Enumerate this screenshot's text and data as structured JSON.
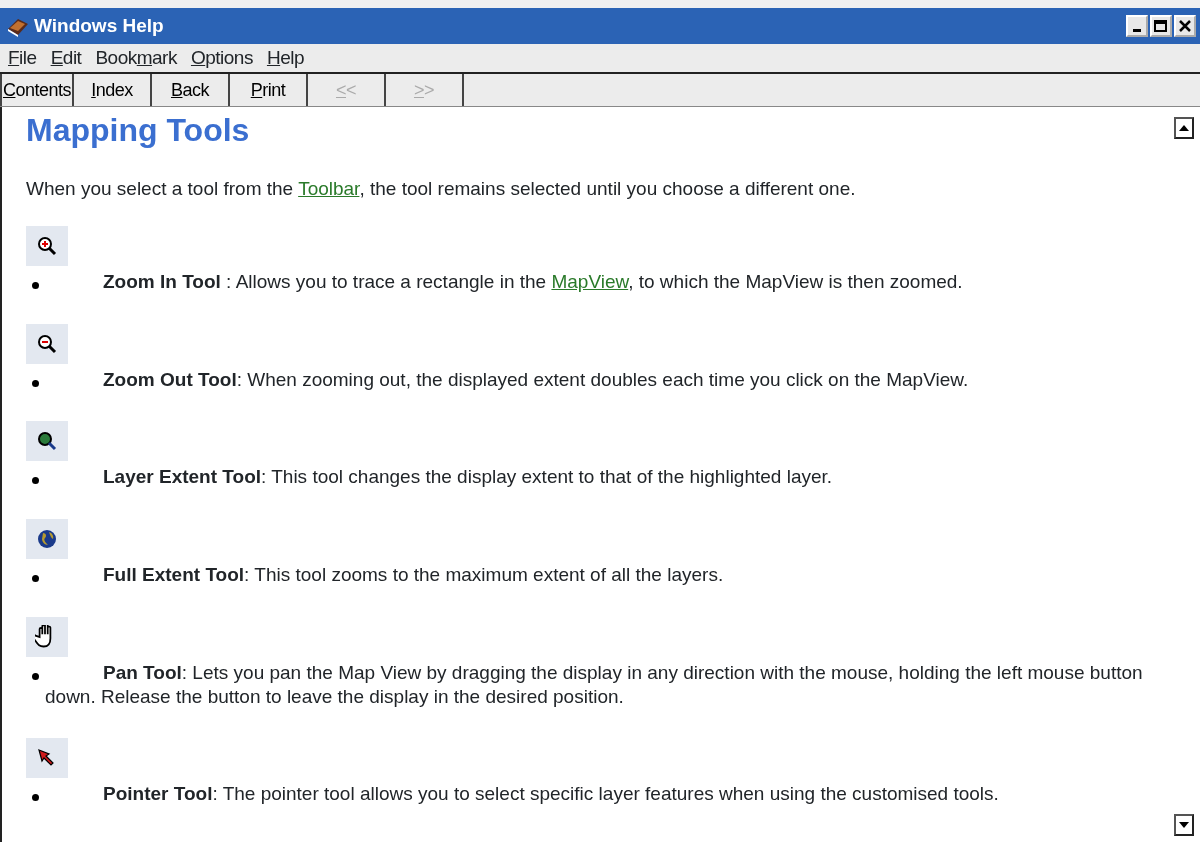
{
  "window": {
    "title": "Windows Help"
  },
  "menu": [
    {
      "key": "F",
      "after": "ile"
    },
    {
      "key": "E",
      "after": "dit"
    },
    {
      "before": "Book",
      "key": "m",
      "after": "ark"
    },
    {
      "key": "O",
      "after": "ptions"
    },
    {
      "key": "H",
      "after": "elp"
    }
  ],
  "toolbar": [
    {
      "key": "C",
      "after": "ontents",
      "disabled": false
    },
    {
      "key": "I",
      "after": "ndex",
      "disabled": false
    },
    {
      "key": "B",
      "after": "ack",
      "disabled": false
    },
    {
      "key": "P",
      "after": "rint",
      "disabled": false
    },
    {
      "key": "<",
      "after": "<",
      "disabled": true
    },
    {
      "key": ">",
      "after": ">",
      "disabled": true
    }
  ],
  "topic": {
    "title": "Mapping Tools",
    "intro": [
      {
        "text": "When you select a tool from the ",
        "link": false
      },
      {
        "text": "Toolbar",
        "link": true
      },
      {
        "text": ", the tool remains selected until you choose a different one.",
        "link": false
      }
    ],
    "tools": [
      {
        "kind": "zoom-in",
        "term": "Zoom In Tool",
        "text": [
          {
            "text": " : Allows you to trace a rectangle in the ",
            "link": false
          },
          {
            "text": "MapView",
            "link": true
          },
          {
            "text": ", to which the MapView is then zoomed.",
            "link": false
          }
        ]
      },
      {
        "kind": "zoom-out",
        "term": "Zoom Out Tool",
        "text": [
          {
            "text": ": When zooming out, the displayed extent doubles each time you click on the MapView.",
            "link": false
          }
        ]
      },
      {
        "kind": "layer-extent",
        "term": "Layer Extent Tool",
        "text": [
          {
            "text": ": This tool changes the display extent to that of the highlighted layer.",
            "link": false
          }
        ]
      },
      {
        "kind": "full-extent",
        "term": "Full Extent Tool",
        "text": [
          {
            "text": ": This tool zooms to the maximum extent of all the layers.",
            "link": false
          }
        ]
      },
      {
        "kind": "pan",
        "term": "Pan Tool",
        "text": [
          {
            "text": ": Lets you pan the Map View by dragging the display in any direction with the mouse, holding the left mouse button down. Release the button to leave the display in the desired position.",
            "link": false
          }
        ]
      },
      {
        "kind": "pointer",
        "term": "Pointer Tool",
        "text": [
          {
            "text": ": The pointer tool allows you to select specific layer features when using the customised tools.",
            "link": false
          }
        ]
      }
    ]
  }
}
